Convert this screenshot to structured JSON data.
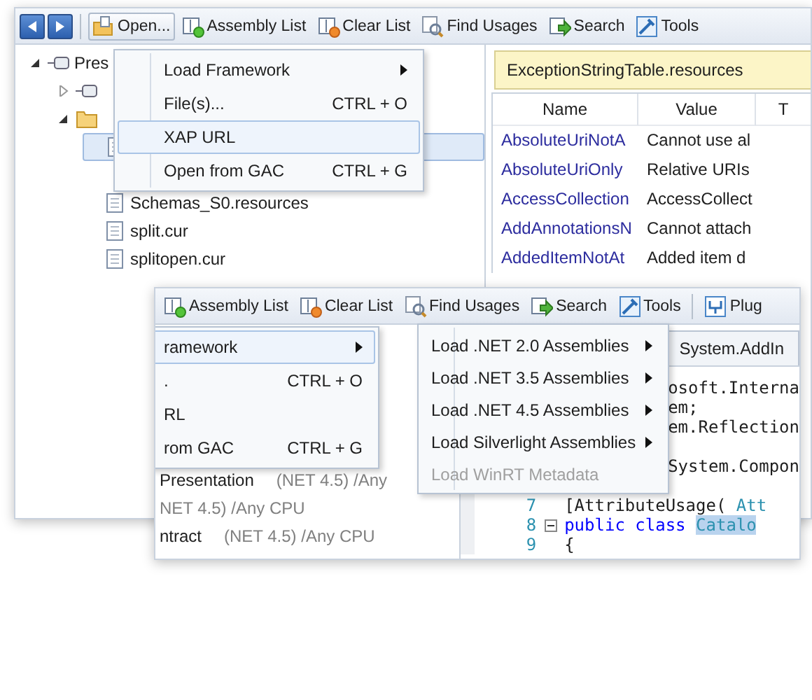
{
  "back_window": {
    "toolbar": [
      {
        "label": "Open...",
        "kind": "open",
        "pressed": true
      },
      {
        "label": "Assembly List",
        "kind": "list",
        "pressed": false
      },
      {
        "label": "Clear List",
        "kind": "clear",
        "pressed": false
      },
      {
        "label": "Find Usages",
        "kind": "find",
        "pressed": false
      },
      {
        "label": "Search",
        "kind": "search",
        "pressed": false
      },
      {
        "label": "Tools",
        "kind": "tools",
        "pressed": false
      }
    ],
    "tree": [
      {
        "label": "Pres",
        "kind": "assembly",
        "expanded": true,
        "children": [
          {
            "kind": "assembly",
            "expanded": false
          },
          {
            "kind": "folder",
            "expanded": true,
            "children": [
              {
                "kind": "file",
                "selected": true
              },
              {
                "label": "Schemas_S0.resources",
                "kind": "file",
                "selected": false
              },
              {
                "label": "split.cur",
                "kind": "file",
                "selected": false
              },
              {
                "label": "splitopen.cur",
                "kind": "file",
                "selected": false
              }
            ]
          }
        ]
      }
    ],
    "menu": [
      {
        "label": "Load Framework",
        "submenu": true,
        "selected": false
      },
      {
        "label": "File(s)...",
        "shortcut": "CTRL + O",
        "submenu": false,
        "selected": false
      },
      {
        "label": "XAP URL",
        "submenu": false,
        "selected": true
      },
      {
        "label": "Open from GAC",
        "shortcut": "CTRL + G",
        "submenu": false,
        "selected": false
      }
    ],
    "document_tab": "ExceptionStringTable.resources",
    "table": {
      "columns": [
        "Name",
        "Value",
        "T"
      ],
      "rows": [
        [
          "AbsoluteUriNotA",
          "Cannot use al"
        ],
        [
          "AbsoluteUriOnly",
          "Relative URIs"
        ],
        [
          "AccessCollection",
          "AccessCollect"
        ],
        [
          "AddAnnotationsN",
          "Cannot attach"
        ],
        [
          "AddedItemNotAt",
          "Added item d"
        ]
      ]
    }
  },
  "front_window": {
    "toolbar": [
      {
        "label": "Assembly List",
        "kind": "list",
        "pressed": false
      },
      {
        "label": "Clear List",
        "kind": "clear",
        "pressed": false
      },
      {
        "label": "Find Usages",
        "kind": "find",
        "pressed": false
      },
      {
        "label": "Search",
        "kind": "search",
        "pressed": false
      },
      {
        "label": "Tools",
        "kind": "tools",
        "pressed": false
      },
      {
        "label": "Plug",
        "kind": "plugin",
        "pressed": false,
        "separator_before": true
      }
    ],
    "menu": [
      {
        "label": "ramework",
        "submenu": true,
        "selected": true
      },
      {
        "label": ".",
        "shortcut": "CTRL + O",
        "submenu": false,
        "selected": false
      },
      {
        "label": "RL",
        "submenu": false,
        "selected": false
      },
      {
        "label": "rom GAC",
        "shortcut": "CTRL + G",
        "submenu": false,
        "selected": false
      }
    ],
    "submenu": [
      {
        "label": "Load .NET 2.0 Assemblies",
        "submenu": true,
        "disabled": false
      },
      {
        "label": "Load .NET 3.5 Assemblies",
        "submenu": true,
        "disabled": false
      },
      {
        "label": "Load .NET 4.5 Assemblies",
        "submenu": true,
        "disabled": false
      },
      {
        "label": "Load Silverlight Assemblies",
        "submenu": true,
        "disabled": false
      },
      {
        "label": "Load WinRT Metadata",
        "submenu": false,
        "disabled": true
      }
    ],
    "assemblies": [
      {
        "name": "Presentation",
        "info": "(NET 4.5) /Any"
      },
      {
        "info": "NET 4.5) /Any CPU"
      },
      {
        "name": "ntract",
        "info": "(NET 4.5) /Any CPU"
      }
    ],
    "document_tab": "System.AddIn",
    "code": [
      {
        "kind": "partial",
        "parts": [
          {
            "kind": "plain",
            "text": "osoft.Interna"
          }
        ]
      },
      {
        "kind": "partial",
        "parts": [
          {
            "kind": "plain",
            "text": "em;"
          }
        ]
      },
      {
        "kind": "partial",
        "parts": [
          {
            "kind": "plain",
            "text": "em.Reflection"
          }
        ]
      },
      {
        "kind": "partial"
      },
      {
        "kind": "partial",
        "parts": [
          {
            "kind": "plain",
            "text": "System.Compon"
          }
        ]
      },
      {
        "kind": "partial"
      },
      {
        "kind": "numbered",
        "number": "7",
        "fold": false,
        "parts": [
          {
            "kind": "plain",
            "text": "[AttributeUsage("
          },
          {
            "kind": "type",
            "text": "Att"
          }
        ]
      },
      {
        "kind": "numbered",
        "number": "8",
        "fold": true,
        "parts": [
          {
            "kind": "keyword",
            "text": "public class"
          },
          {
            "kind": "highlight",
            "text": "Catalo"
          }
        ]
      },
      {
        "kind": "numbered",
        "number": "9",
        "fold": false,
        "parts": [
          {
            "kind": "plain",
            "text": "{"
          }
        ]
      }
    ]
  }
}
